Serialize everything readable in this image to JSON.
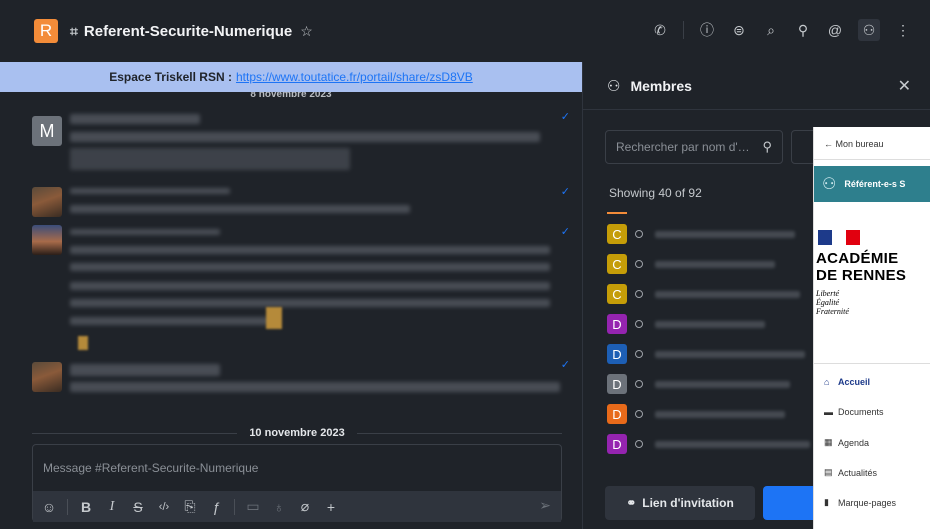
{
  "header": {
    "room_avatar_letter": "R",
    "room_name": "Referent-Securite-Numerique",
    "icons": [
      "call-icon",
      "info-icon",
      "threads-icon",
      "discussion-icon",
      "search-icon",
      "mention-icon",
      "members-icon",
      "kebab-icon"
    ]
  },
  "announcement": {
    "label": "Espace Triskell RSN :",
    "url": "https://www.toutatice.fr/portail/share/zsD8VB"
  },
  "chat": {
    "date_top": "8 novembre 2023",
    "avatar_m": "M",
    "date_separator": "10 novembre 2023",
    "composer_placeholder": "Message #Referent-Securite-Numerique"
  },
  "members": {
    "title": "Membres",
    "search_placeholder": "Rechercher par nom d'…",
    "showing": "Showing 40 of 92",
    "list": [
      {
        "letter": "C",
        "color": "#c59d08"
      },
      {
        "letter": "C",
        "color": "#c59d08"
      },
      {
        "letter": "C",
        "color": "#c59d08"
      },
      {
        "letter": "D",
        "color": "#9524b0"
      },
      {
        "letter": "D",
        "color": "#1d5fb5"
      },
      {
        "letter": "D",
        "color": "#6c727a"
      },
      {
        "letter": "D",
        "color": "#e86a1a"
      },
      {
        "letter": "D",
        "color": "#9524b0"
      }
    ],
    "invite_label": "Lien d'invitation"
  },
  "overlay": {
    "back": "Mon bureau",
    "band_label": "Référent-e-s S",
    "acad_line1": "ACADÉMIE",
    "acad_line2": "DE RENNES",
    "motto1": "Liberté",
    "motto2": "Égalité",
    "motto3": "Fraternité",
    "nav": [
      "Accueil",
      "Documents",
      "Agenda",
      "Actualités",
      "Marque-pages"
    ]
  }
}
